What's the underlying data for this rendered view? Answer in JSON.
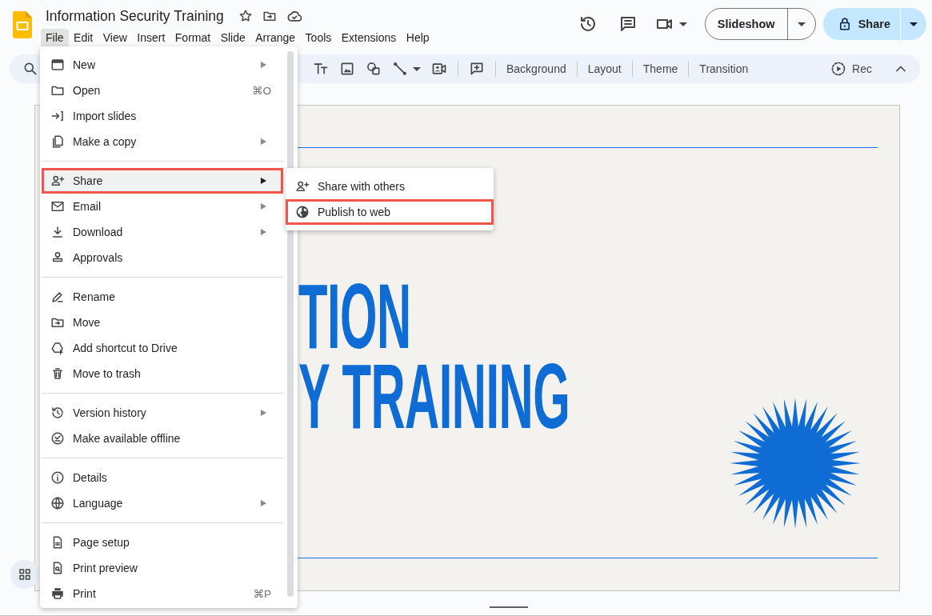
{
  "document": {
    "title": "Information Security Training"
  },
  "menubar": [
    {
      "label": "File",
      "selected": true
    },
    {
      "label": "Edit",
      "selected": false
    },
    {
      "label": "View",
      "selected": false
    },
    {
      "label": "Insert",
      "selected": false
    },
    {
      "label": "Format",
      "selected": false
    },
    {
      "label": "Slide",
      "selected": false
    },
    {
      "label": "Arrange",
      "selected": false
    },
    {
      "label": "Tools",
      "selected": false
    },
    {
      "label": "Extensions",
      "selected": false
    },
    {
      "label": "Help",
      "selected": false
    }
  ],
  "actions": {
    "slideshow": "Slideshow",
    "share": "Share"
  },
  "toolbar": {
    "buttons": [
      "Background",
      "Layout",
      "Theme",
      "Transition"
    ],
    "record": "Rec"
  },
  "slide": {
    "heading_lines": [
      "TION",
      "Y TRAINING"
    ]
  },
  "file_menu": {
    "groups": [
      {
        "items": [
          {
            "kind": "new",
            "label": "New",
            "submenu": true,
            "selected": false,
            "outlined": false
          },
          {
            "kind": "open",
            "label": "Open",
            "shortcut": "⌘O",
            "submenu": false,
            "selected": false,
            "outlined": false
          },
          {
            "kind": "import",
            "label": "Import slides",
            "submenu": false,
            "selected": false,
            "outlined": false
          },
          {
            "kind": "copy",
            "label": "Make a copy",
            "submenu": true,
            "selected": false,
            "outlined": false
          }
        ]
      },
      {
        "items": [
          {
            "kind": "share",
            "label": "Share",
            "submenu": true,
            "selected": true,
            "outlined": true
          },
          {
            "kind": "email",
            "label": "Email",
            "submenu": true,
            "selected": false,
            "outlined": false
          },
          {
            "kind": "download",
            "label": "Download",
            "submenu": true,
            "selected": false,
            "outlined": false
          },
          {
            "kind": "approvals",
            "label": "Approvals",
            "submenu": false,
            "selected": false,
            "outlined": false
          }
        ]
      },
      {
        "items": [
          {
            "kind": "rename",
            "label": "Rename",
            "submenu": false,
            "selected": false,
            "outlined": false
          },
          {
            "kind": "move",
            "label": "Move",
            "submenu": false,
            "selected": false,
            "outlined": false
          },
          {
            "kind": "shortcut",
            "label": "Add shortcut to Drive",
            "submenu": false,
            "selected": false,
            "outlined": false
          },
          {
            "kind": "trash",
            "label": "Move to trash",
            "submenu": false,
            "selected": false,
            "outlined": false
          }
        ]
      },
      {
        "items": [
          {
            "kind": "history",
            "label": "Version history",
            "submenu": true,
            "selected": false,
            "outlined": false
          },
          {
            "kind": "offline",
            "label": "Make available offline",
            "submenu": false,
            "selected": false,
            "outlined": false
          }
        ]
      },
      {
        "items": [
          {
            "kind": "details",
            "label": "Details",
            "submenu": false,
            "selected": false,
            "outlined": false
          },
          {
            "kind": "language",
            "label": "Language",
            "submenu": true,
            "selected": false,
            "outlined": false
          }
        ]
      },
      {
        "items": [
          {
            "kind": "page_setup",
            "label": "Page setup",
            "submenu": false,
            "selected": false,
            "outlined": false
          },
          {
            "kind": "print_preview",
            "label": "Print preview",
            "submenu": false,
            "selected": false,
            "outlined": false
          },
          {
            "kind": "print",
            "label": "Print",
            "shortcut": "⌘P",
            "submenu": false,
            "selected": false,
            "outlined": false
          }
        ]
      }
    ]
  },
  "share_submenu": {
    "items": [
      {
        "kind": "share",
        "label": "Share with others",
        "selected": false,
        "outlined": false
      },
      {
        "kind": "publish",
        "label": "Publish to web",
        "selected": false,
        "outlined": true
      }
    ]
  }
}
